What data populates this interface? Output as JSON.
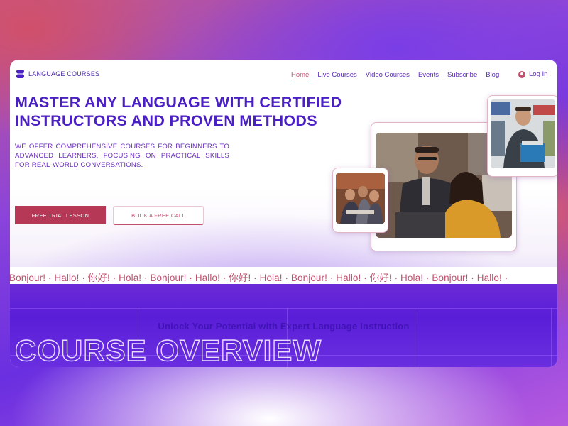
{
  "brand": {
    "name": "LANGUAGE COURSES"
  },
  "nav": {
    "items": [
      "Home",
      "Live Courses",
      "Video Courses",
      "Events",
      "Subscribe",
      "Blog"
    ],
    "active": "Home",
    "login_label": "Log In"
  },
  "hero": {
    "headline_line1": "MASTER ANY LANGUAGE WITH CERTIFIED",
    "headline_line2": "INSTRUCTORS AND PROVEN METHODS",
    "description": "WE OFFER COMPREHENSIVE COURSES FOR BEGINNERS TO ADVANCED LEARNERS, FOCUSING ON PRACTICAL SKILLS FOR REAL-WORLD CONVERSATIONS.",
    "primary_button": "FREE TRIAL LESSON",
    "secondary_button": "BOOK A FREE CALL"
  },
  "ticker": {
    "text": "Bonjour! · Hallo! · 你好!  ·  Hola! · Bonjour! · Hallo! · 你好!  ·  Hola! · Bonjour! · Hallo! · 你好!  ·  Hola! · Bonjour! · Hallo! ·"
  },
  "overview": {
    "subtitle": "Unlock Your Potential with Expert Language Instruction",
    "title": "COURSE OVERVIEW"
  },
  "colors": {
    "primary_purple": "#4a1fc3",
    "accent_pink": "#c0506e",
    "button_red": "#b53856"
  },
  "icons": {
    "logo": "brand-logo-icon",
    "login": "user-icon"
  }
}
